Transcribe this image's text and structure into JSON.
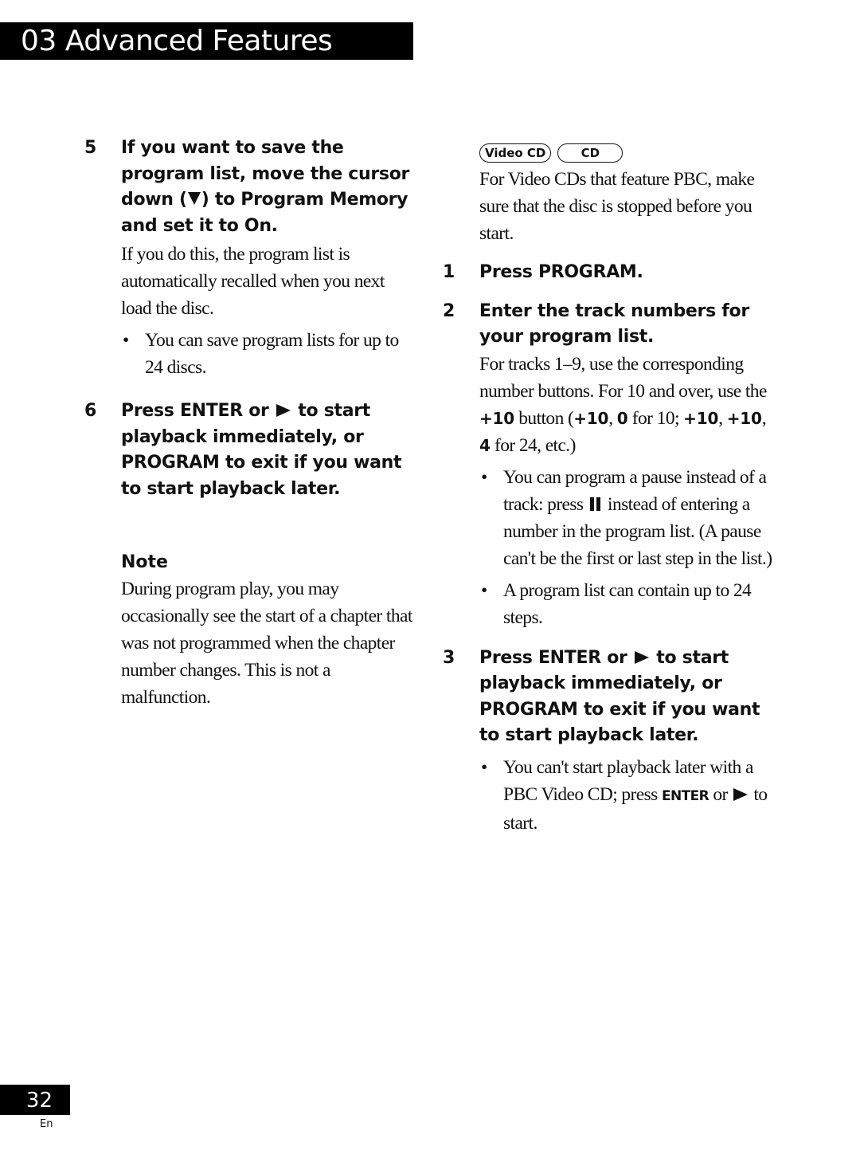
{
  "header": {
    "title": "03 Advanced Features"
  },
  "left": {
    "step5": {
      "num": "5",
      "head_before": "If you want to save the program list, move the cursor down (",
      "head_after": ") to Program Memory and set it to On.",
      "body": "If you do this, the program list is automatically recalled when you next load the disc.",
      "bullet": "You can save program lists for up to 24 discs."
    },
    "step6": {
      "num": "6",
      "head_before": "Press ENTER or ",
      "head_after": " to start playback immediately, or PROGRAM to exit if you want to start playback later."
    },
    "note": {
      "title": "Note",
      "body": "During program play, you may occasionally see the start of a chapter that was not programmed when the chapter number changes. This is not a malfunction."
    }
  },
  "right": {
    "badges": [
      "Video CD",
      "CD"
    ],
    "intro": "For Video CDs that feature PBC, make sure that the disc is stopped before you start.",
    "step1": {
      "num": "1",
      "head": "Press PROGRAM."
    },
    "step2": {
      "num": "2",
      "head": "Enter the track numbers for your program list.",
      "body_1": "For tracks 1–9, use the corresponding number buttons. For 10 and over, use the ",
      "kw_plus10": "+10",
      "body_2": " button (",
      "kw_a": "+10",
      "sep_1": ", ",
      "kw_b": "0",
      "body_3": " for 10; ",
      "kw_c": "+10",
      "sep_2": ", ",
      "kw_d": "+10",
      "sep_3": ", ",
      "kw_e": "4",
      "body_4": " for 24, etc.)",
      "bullet1_before": "You can program a pause instead of a track: press ",
      "bullet1_after": " instead of entering a number in the program list. (A pause can't be the first or last step in the list.)",
      "bullet2": "A program list can contain up to 24 steps."
    },
    "step3": {
      "num": "3",
      "head_before": "Press ENTER or ",
      "head_after": " to start playback immediately, or PROGRAM to exit if you want to start playback later.",
      "bullet_before": "You can't start playback later with a PBC Video CD; press ",
      "bullet_kw": "ENTER",
      "bullet_mid": " or ",
      "bullet_after": " to start."
    }
  },
  "footer": {
    "page_number": "32",
    "language": "En"
  },
  "icons": {
    "bullet": "•"
  }
}
